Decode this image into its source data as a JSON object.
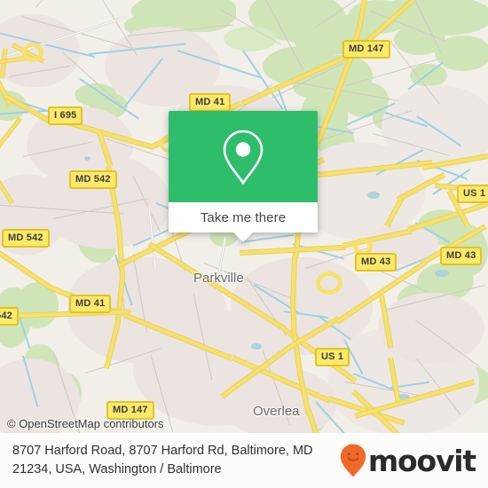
{
  "map": {
    "attribution": "© OpenStreetMap contributors",
    "places": [
      {
        "name": "Parkville",
        "label": "Parkville"
      },
      {
        "name": "Overlea",
        "label": "Overlea"
      }
    ],
    "road_shields": [
      {
        "name": "md-147-north",
        "label": "MD 147"
      },
      {
        "name": "md-41-north",
        "label": "MD 41"
      },
      {
        "name": "i-695",
        "label": "I 695"
      },
      {
        "name": "md-542-upper",
        "label": "MD 542"
      },
      {
        "name": "md-542-lower",
        "label": "MD 542"
      },
      {
        "name": "md-542-edge",
        "label": "542"
      },
      {
        "name": "us-1-right",
        "label": "US 1"
      },
      {
        "name": "md-43-center",
        "label": "MD 43"
      },
      {
        "name": "md-43-right",
        "label": "MD 43"
      },
      {
        "name": "md-41-south",
        "label": "MD 41"
      },
      {
        "name": "us-1-south",
        "label": "US 1"
      },
      {
        "name": "md-147-south",
        "label": "MD 147"
      }
    ],
    "colors": {
      "land": "#f2efe9",
      "green": "#cfe5b8",
      "urban": "#ece4e0",
      "water": "#aad3df",
      "road": "#f7e06e",
      "shield_border": "#e2c41f"
    }
  },
  "callout": {
    "button_label": "Take me there",
    "marker_icon": "map-pin-icon",
    "accent_color": "#2ebd6b"
  },
  "footer": {
    "address": "8707 Harford Road, 8707 Harford Rd, Baltimore, MD 21234, USA, Washington / Baltimore",
    "brand": "moovit",
    "brand_icon": "moovit-smiley-pin-icon",
    "brand_color": "#ef6a28"
  }
}
